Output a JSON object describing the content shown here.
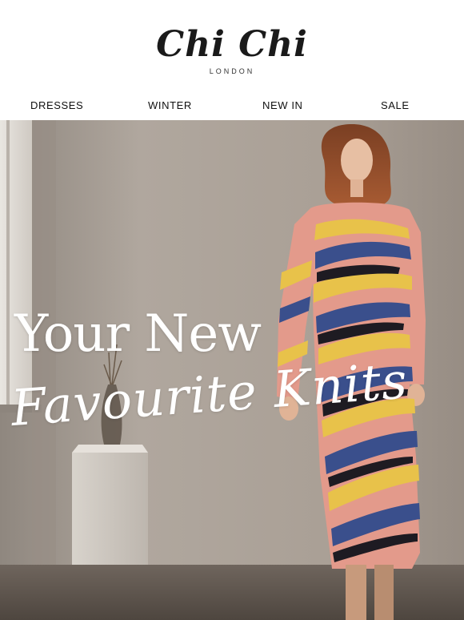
{
  "brand": {
    "name": "Chi Chi",
    "location": "LONDON"
  },
  "nav": {
    "items": [
      {
        "label": "DRESSES"
      },
      {
        "label": "WINTER"
      },
      {
        "label": "NEW IN"
      },
      {
        "label": "SALE"
      }
    ]
  },
  "hero": {
    "headline_line1": "Your New",
    "headline_line2": "Favourite Knits"
  },
  "colors": {
    "background": "#ffffff",
    "hero_wall": "#a89f96",
    "dress_pink": "#e39a8b",
    "dress_yellow": "#e8c24a",
    "dress_blue": "#3a4f8c",
    "text_light": "#ffffff"
  }
}
